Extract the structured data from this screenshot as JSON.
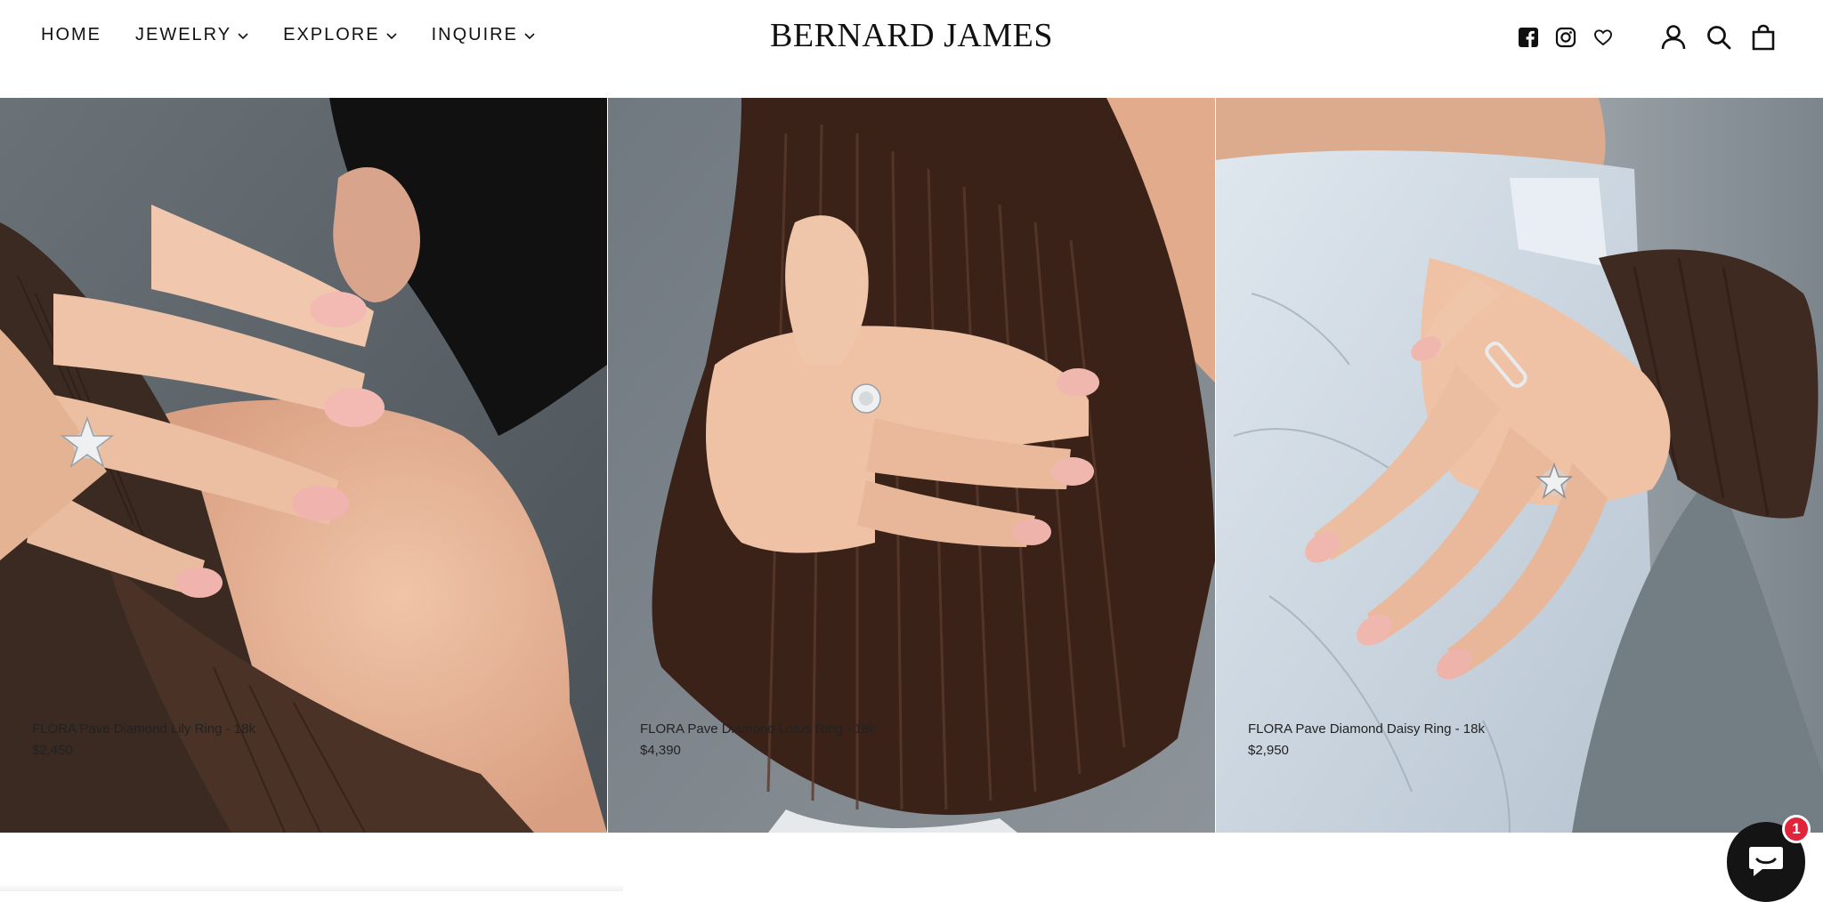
{
  "nav": {
    "items": [
      {
        "label": "HOME",
        "has_dropdown": false
      },
      {
        "label": "JEWELRY",
        "has_dropdown": true
      },
      {
        "label": "EXPLORE",
        "has_dropdown": true
      },
      {
        "label": "INQUIRE",
        "has_dropdown": true
      }
    ]
  },
  "brand": {
    "name": "BERNARD JAMES"
  },
  "header_icons": [
    "facebook-icon",
    "instagram-icon",
    "heart-icon",
    "account-icon",
    "search-icon",
    "cart-icon"
  ],
  "products": [
    {
      "name": "FLORA Pave Diamond Lily Ring - 18k",
      "price": "$2,450",
      "photo": "hand-with-star-ring-on-shoulder"
    },
    {
      "name": "FLORA Pave Diamond Lotus Ring - 18k",
      "price": "$4,390",
      "photo": "hand-with-flower-ring-on-knit-sleeve"
    },
    {
      "name": "FLORA Pave Diamond Daisy Ring - 18k",
      "price": "$2,950",
      "photo": "hand-with-daisy-ring-on-denim"
    }
  ],
  "chat": {
    "badge_count": "1"
  },
  "colors": {
    "text": "#111111",
    "badge": "#e0243a",
    "chat_bg": "#141414"
  }
}
